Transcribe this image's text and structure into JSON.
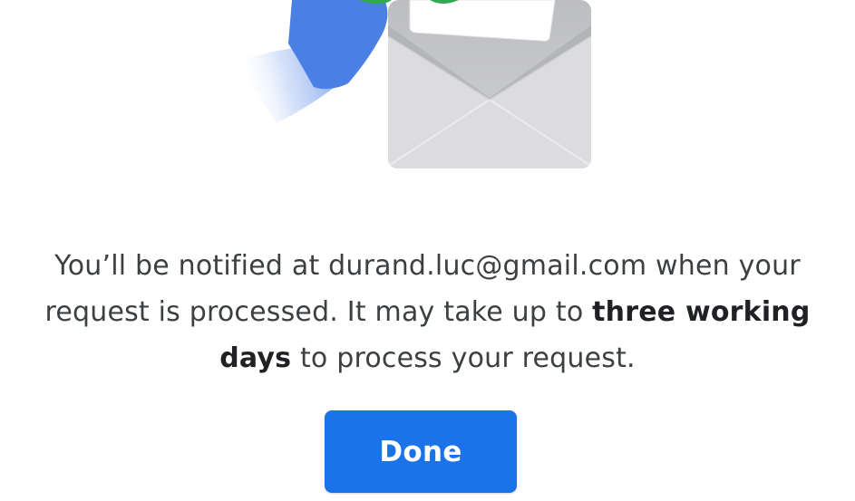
{
  "confirmation": {
    "message_part1": "You’ll be notified at durand.luc@gmail.com when your request is processed. It may take up to ",
    "message_bold1": "three working days",
    "message_part2": " to process your request."
  },
  "actions": {
    "done_label": "Done"
  },
  "illustration": {
    "icon": "envelope-with-hand-icon"
  },
  "colors": {
    "accent": "#1a73e8",
    "hand": "#4a7fe3",
    "envelope": "#dadce0",
    "text": "#3c4043"
  }
}
